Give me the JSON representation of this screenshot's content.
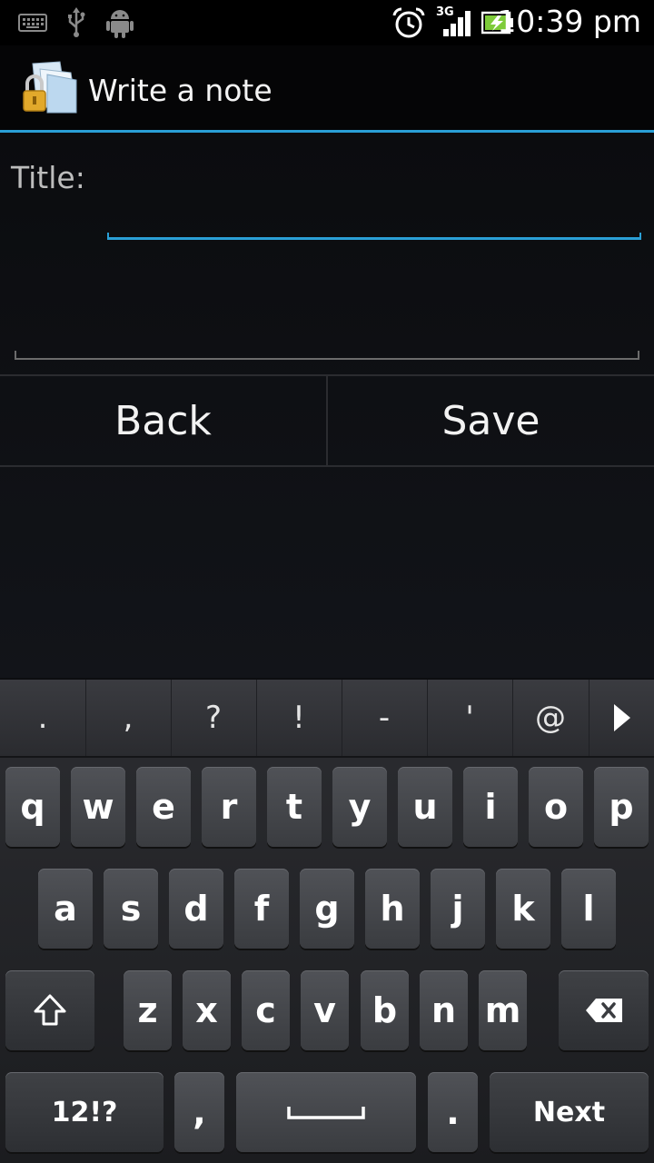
{
  "status_bar": {
    "time": "10:39 pm",
    "network": "3G",
    "icons": [
      "keyboard-icon",
      "usb-icon",
      "android-icon",
      "alarm-icon",
      "signal-icon",
      "battery-icon"
    ]
  },
  "action_bar": {
    "title": "Write a note",
    "icon": "secure-notes-app-icon",
    "accent_color": "#2a9fd6"
  },
  "form": {
    "title_label": "Title:",
    "title_value": "",
    "body_value": ""
  },
  "buttons": {
    "back": "Back",
    "save": "Save"
  },
  "keyboard": {
    "suggestions": [
      ".",
      ",",
      "?",
      "!",
      "-",
      "'",
      "@"
    ],
    "row1": [
      "q",
      "w",
      "e",
      "r",
      "t",
      "y",
      "u",
      "i",
      "o",
      "p"
    ],
    "row2": [
      "a",
      "s",
      "d",
      "f",
      "g",
      "h",
      "j",
      "k",
      "l"
    ],
    "row3": [
      "z",
      "x",
      "c",
      "v",
      "b",
      "n",
      "m"
    ],
    "symbols_label": "12!?",
    "comma": ",",
    "period": ".",
    "next_label": "Next"
  }
}
